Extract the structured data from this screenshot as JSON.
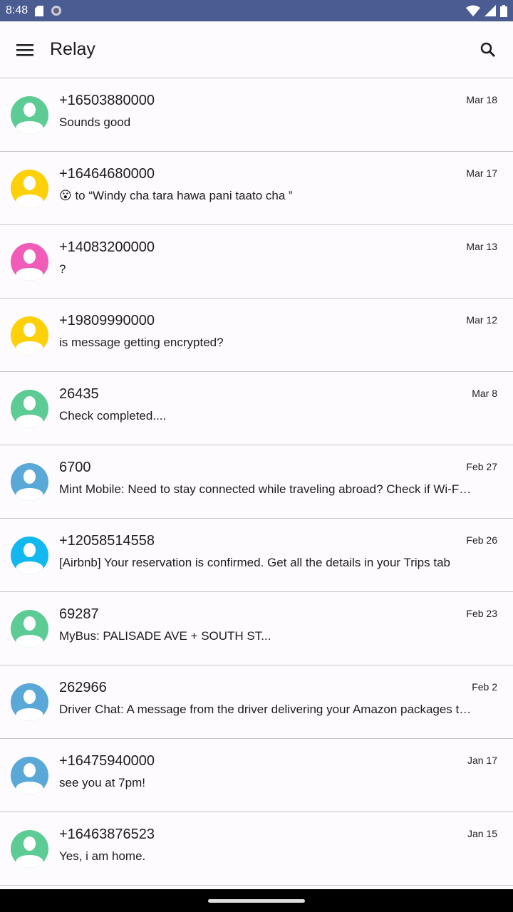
{
  "status": {
    "time": "8:48"
  },
  "appbar": {
    "title": "Relay"
  },
  "colors": {
    "statusbar": "#4a5c91",
    "green": "#5ccb94",
    "yellow": "#fdd00a",
    "pink": "#f05cb8",
    "blue": "#5aa8d8",
    "cyan": "#14b8f0"
  },
  "conversations": [
    {
      "name": "+16503880000",
      "snippet": "Sounds good",
      "date": "Mar 18",
      "color": "#5ccb94"
    },
    {
      "name": "+16464680000",
      "snippet": "😮 to “Windy cha tara hawa pani taato cha ”",
      "date": "Mar 17",
      "color": "#fdd00a"
    },
    {
      "name": "+14083200000",
      "snippet": "?",
      "date": "Mar 13",
      "color": "#f05cb8"
    },
    {
      "name": "+19809990000",
      "snippet": "is message getting encrypted?",
      "date": "Mar 12",
      "color": "#fdd00a"
    },
    {
      "name": "26435",
      "snippet": "Check completed....",
      "date": "Mar 8",
      "color": "#5ccb94"
    },
    {
      "name": "6700",
      "snippet": "Mint Mobile: Need to stay connected while traveling abroad? Check if Wi-Fi calling is available",
      "date": "Feb 27",
      "color": "#5aa8d8"
    },
    {
      "name": "+12058514558",
      "snippet": "[Airbnb] Your reservation is confirmed. Get all the details in your Trips tab",
      "date": "Feb 26",
      "color": "#14b8f0"
    },
    {
      "name": "69287",
      "snippet": "MyBus: PALISADE AVE + SOUTH ST...",
      "date": "Feb 23",
      "color": "#5ccb94"
    },
    {
      "name": "262966",
      "snippet": "Driver Chat: A message from the driver delivering your Amazon packages today",
      "date": "Feb 2",
      "color": "#5aa8d8"
    },
    {
      "name": "+16475940000",
      "snippet": "see you at 7pm!",
      "date": "Jan 17",
      "color": "#5aa8d8"
    },
    {
      "name": "+16463876523",
      "snippet": "Yes, i am home.",
      "date": "Jan 15",
      "color": "#5ccb94"
    }
  ]
}
